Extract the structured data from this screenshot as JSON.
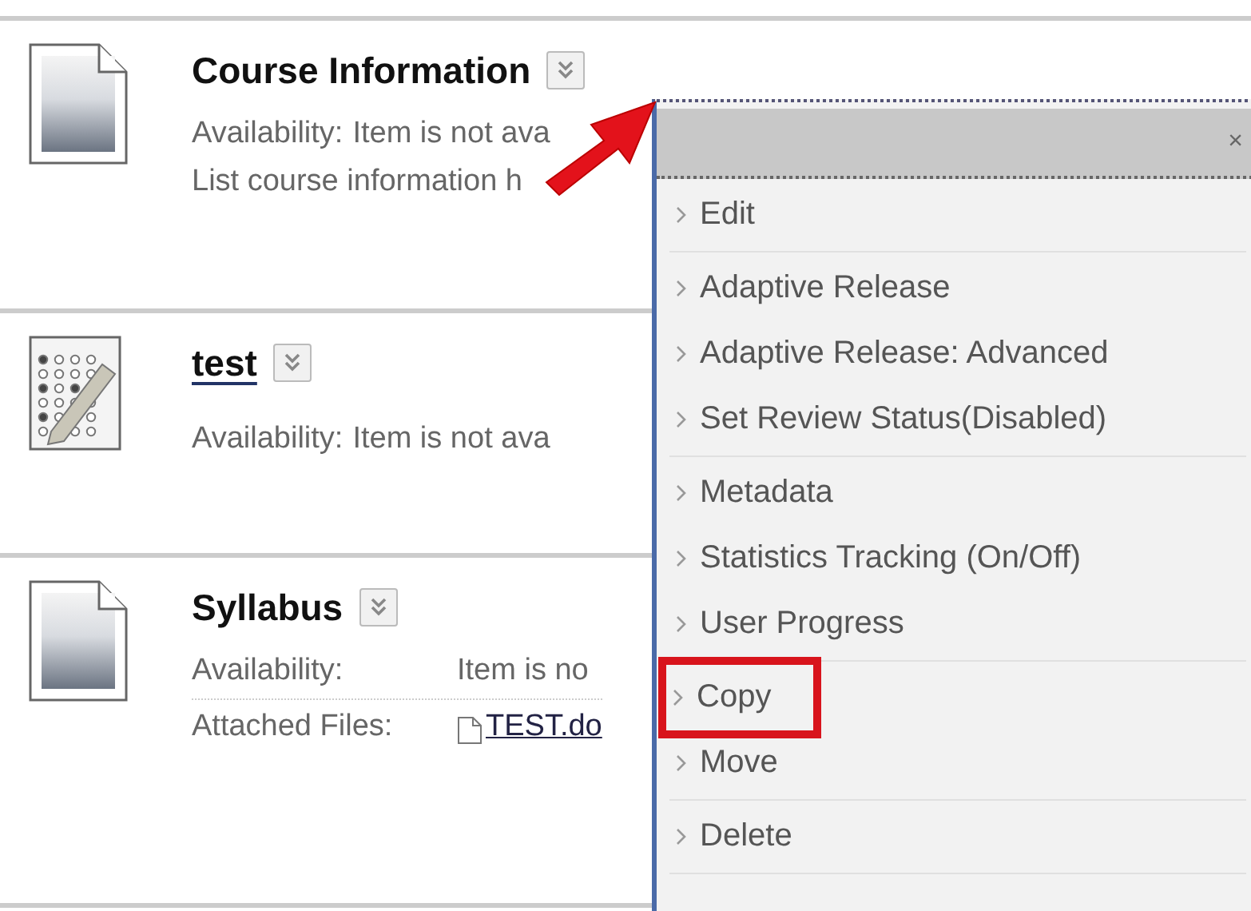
{
  "items": [
    {
      "kind": "document",
      "title": "Course Information",
      "link": false,
      "lines": [
        {
          "label": "Availability:",
          "value": "Item is not ava"
        }
      ],
      "description": "List course information h"
    },
    {
      "kind": "test",
      "title": "test",
      "link": true,
      "lines": [
        {
          "label": "Availability:",
          "value": "Item is not ava"
        }
      ]
    },
    {
      "kind": "document",
      "title": "Syllabus",
      "link": false,
      "lines": [
        {
          "label": "Availability:",
          "value": "Item is no"
        },
        {
          "label": "Attached Files:",
          "file": "TEST.do"
        }
      ]
    }
  ],
  "menu": {
    "close": "×",
    "groups": [
      [
        {
          "label": "Edit",
          "highlighted": false
        }
      ],
      [
        {
          "label": "Adaptive Release",
          "highlighted": false
        },
        {
          "label": "Adaptive Release: Advanced",
          "highlighted": false
        },
        {
          "label": "Set Review Status(Disabled)",
          "highlighted": false
        }
      ],
      [
        {
          "label": "Metadata",
          "highlighted": false
        },
        {
          "label": "Statistics Tracking (On/Off)",
          "highlighted": false
        },
        {
          "label": "User Progress",
          "highlighted": false
        }
      ],
      [
        {
          "label": "Copy",
          "highlighted": true
        },
        {
          "label": "Move",
          "highlighted": false
        }
      ],
      [
        {
          "label": "Delete",
          "highlighted": false
        }
      ]
    ]
  }
}
